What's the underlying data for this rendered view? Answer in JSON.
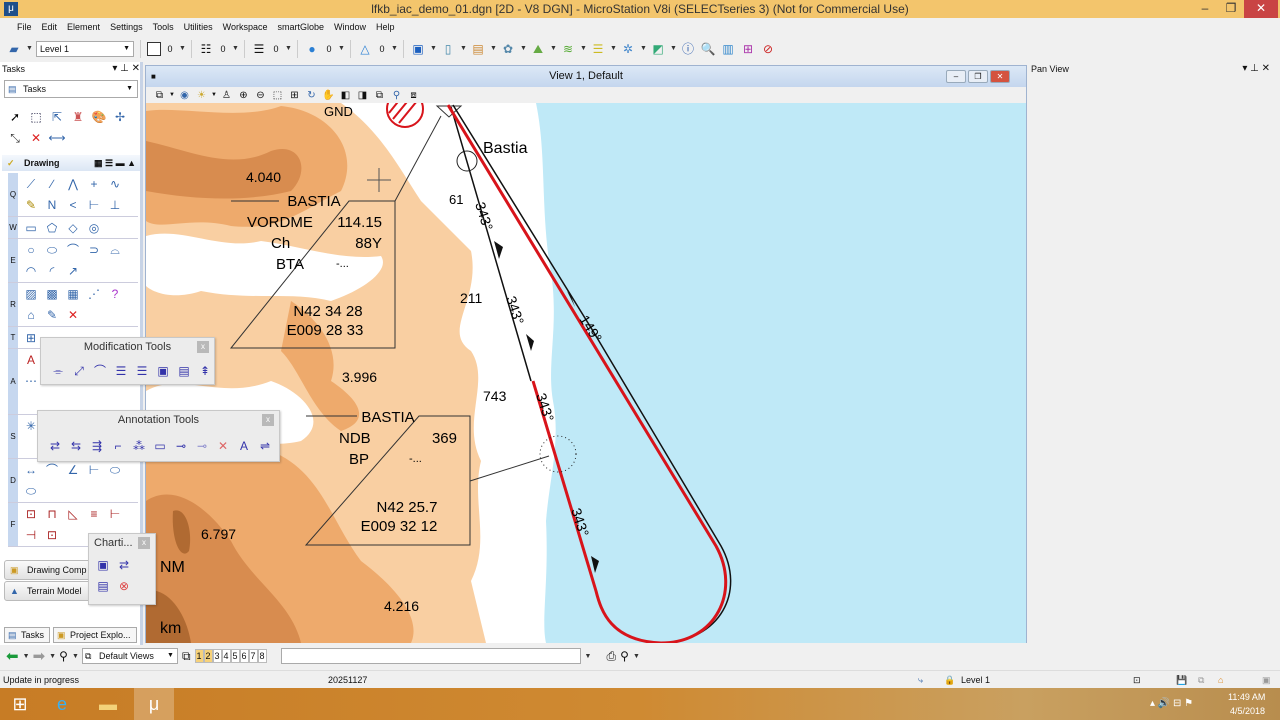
{
  "titlebar": {
    "title": "lfkb_iac_demo_01.dgn [2D - V8 DGN] - MicroStation V8i (SELECTseries 3) (Not for Commercial Use)",
    "minimize": "–",
    "restore": "❐",
    "close": "✕"
  },
  "menu": [
    "File",
    "Edit",
    "Element",
    "Settings",
    "Tools",
    "Utilities",
    "Workspace",
    "smartGlobe",
    "Window",
    "Help"
  ],
  "toolbar": {
    "level": "Level 1",
    "color": "0",
    "style": "0",
    "weight": "0",
    "transparency": "0",
    "priority": "0"
  },
  "tasks": {
    "title": "Tasks",
    "select_value": "Tasks",
    "quick_icons": [
      {
        "name": "select-icon",
        "g": "➚",
        "c": "#000"
      },
      {
        "name": "fence-icon",
        "g": "⬚",
        "c": "#224"
      },
      {
        "name": "move-icon",
        "g": "⇱",
        "c": "#36a"
      },
      {
        "name": "stamp-icon",
        "g": "♜",
        "c": "#c55"
      },
      {
        "name": "palette-icon",
        "g": "🎨",
        "c": "#c72"
      },
      {
        "name": "snap-icon",
        "g": "✢",
        "c": "#36a"
      },
      {
        "name": "scale-icon",
        "g": "⤡",
        "c": "#333"
      },
      {
        "name": "delete-icon",
        "g": "✕",
        "c": "#d22"
      },
      {
        "name": "measure-icon",
        "g": "⟷",
        "c": "#36a"
      }
    ],
    "drawing_label": "Drawing",
    "groups": [
      {
        "letter": "Q",
        "icons": [
          {
            "name": "place-smartline-icon",
            "g": "⟋",
            "c": "#36a"
          },
          {
            "name": "line-icon",
            "g": "∕",
            "c": "#36a"
          },
          {
            "name": "multiline-icon",
            "g": "⋀",
            "c": "#36a"
          },
          {
            "name": "point-icon",
            "g": "+",
            "c": "#36a"
          },
          {
            "name": "curve-icon",
            "g": "∿",
            "c": "#36a"
          },
          {
            "name": "freehand-icon",
            "g": "✎",
            "c": "#a80"
          },
          {
            "name": "bspline-icon",
            "g": "N",
            "c": "#36a"
          },
          {
            "name": "stream-icon",
            "g": "<",
            "c": "#36a"
          },
          {
            "name": "construct-icon",
            "g": "⊢",
            "c": "#36a"
          },
          {
            "name": "perpendicular-icon",
            "g": "⊥",
            "c": "#36a"
          }
        ]
      },
      {
        "letter": "W",
        "icons": [
          {
            "name": "rectangle-icon",
            "g": "▭",
            "c": "#36a"
          },
          {
            "name": "polygon-icon",
            "g": "⬠",
            "c": "#36a"
          },
          {
            "name": "shape-icon",
            "g": "◇",
            "c": "#36a"
          },
          {
            "name": "circle-center-icon",
            "g": "◎",
            "c": "#36a"
          }
        ]
      },
      {
        "letter": "E",
        "icons": [
          {
            "name": "circle-icon",
            "g": "○",
            "c": "#36a"
          },
          {
            "name": "ellipse-icon",
            "g": "⬭",
            "c": "#36a"
          },
          {
            "name": "arc-icon",
            "g": "⌒",
            "c": "#36a"
          },
          {
            "name": "arc-edit-icon",
            "g": "⊃",
            "c": "#36a"
          },
          {
            "name": "arc-modify-icon",
            "g": "⌓",
            "c": "#36a"
          },
          {
            "name": "half-ellipse-icon",
            "g": "◠",
            "c": "#36a"
          },
          {
            "name": "quarter-ellipse-icon",
            "g": "◜",
            "c": "#36a"
          },
          {
            "name": "arc-length-icon",
            "g": "↗",
            "c": "#36a"
          }
        ]
      },
      {
        "letter": "R",
        "icons": [
          {
            "name": "hatch-icon",
            "g": "▨",
            "c": "#36a"
          },
          {
            "name": "crosshatch-icon",
            "g": "▩",
            "c": "#36a"
          },
          {
            "name": "pattern-icon",
            "g": "▦",
            "c": "#36a"
          },
          {
            "name": "linear-pattern-icon",
            "g": "⋰",
            "c": "#36a"
          },
          {
            "name": "match-pattern-icon",
            "g": "?",
            "c": "#a3c"
          },
          {
            "name": "show-pattern-icon",
            "g": "⌂",
            "c": "#36a"
          },
          {
            "name": "edit-pattern-icon",
            "g": "✎",
            "c": "#36a"
          },
          {
            "name": "delete-pattern-icon",
            "g": "✕",
            "c": "#d22"
          }
        ]
      },
      {
        "letter": "T",
        "icons": [
          {
            "name": "tag-icon",
            "g": "⊞",
            "c": "#36a"
          }
        ]
      },
      {
        "letter": "A",
        "icons": [
          {
            "name": "place-text-icon",
            "g": "A",
            "c": "#b22"
          },
          {
            "name": "spell-check-icon",
            "g": "?",
            "c": "#a3c"
          },
          {
            "name": "edit-text-icon",
            "g": "A",
            "c": "#b22"
          },
          {
            "name": "display-text-icon",
            "g": "A",
            "c": "#b22"
          },
          {
            "name": "increment-text-icon",
            "g": "A",
            "c": "#b22"
          },
          {
            "name": "fill-text-icon",
            "g": "⋯",
            "c": "#36a"
          }
        ]
      },
      {
        "letter": "S",
        "icons": [
          {
            "name": "place-cell-icon",
            "g": "✳",
            "c": "#36a"
          },
          {
            "name": "select-cell-icon",
            "g": "↗",
            "c": "#333"
          }
        ]
      },
      {
        "letter": "D",
        "icons": [
          {
            "name": "dimension-length-icon",
            "g": "↔",
            "c": "#36a"
          },
          {
            "name": "dimension-angle-icon",
            "g": "⌒",
            "c": "#36a"
          },
          {
            "name": "dimension-angle-lines-icon",
            "g": "∠",
            "c": "#36a"
          },
          {
            "name": "dimension-element-icon",
            "g": "⊢",
            "c": "#36a"
          },
          {
            "name": "dimension-radial-icon",
            "g": "⬭",
            "c": "#36a"
          },
          {
            "name": "dimension-ordinate-icon",
            "g": "⬭",
            "c": "#36a"
          }
        ]
      },
      {
        "letter": "F",
        "icons": [
          {
            "name": "fence-place-icon",
            "g": "⊡",
            "c": "#a22"
          },
          {
            "name": "fence-modify-icon",
            "g": "⊓",
            "c": "#a22"
          },
          {
            "name": "fence-delete-icon",
            "g": "◺",
            "c": "#a22"
          },
          {
            "name": "fence-stretch-icon",
            "g": "≡",
            "c": "#a22"
          },
          {
            "name": "fence-manip-icon",
            "g": "⊢",
            "c": "#a22"
          },
          {
            "name": "fence-copy-icon",
            "g": "⊣",
            "c": "#a22"
          },
          {
            "name": "fence-move-icon",
            "g": "⊡",
            "c": "#a22"
          }
        ]
      }
    ],
    "drawing_comp": "Drawing Comp",
    "terrain_model": "Terrain Model",
    "tab_tasks": "Tasks",
    "tab_project": "Project Explo..."
  },
  "modification_tools": {
    "title": "Modification Tools",
    "icons": [
      {
        "name": "modify-point-icon",
        "g": "⌯",
        "c": "#33a"
      },
      {
        "name": "modify-line-icon",
        "g": "⤢",
        "c": "#33a"
      },
      {
        "name": "modify-arc-icon",
        "g": "⌒",
        "c": "#33a"
      },
      {
        "name": "align-text-icon",
        "g": "☰",
        "c": "#33a"
      },
      {
        "name": "align-text2-icon",
        "g": "☰",
        "c": "#33a"
      },
      {
        "name": "frame-icon",
        "g": "▣",
        "c": "#33a"
      },
      {
        "name": "scale-text-icon",
        "g": "▤",
        "c": "#33a"
      },
      {
        "name": "high-icon",
        "g": "⇞",
        "c": "#33a"
      }
    ]
  },
  "annotation_tools": {
    "title": "Annotation Tools",
    "icons": [
      {
        "name": "annotate-1-icon",
        "g": "⇄",
        "c": "#33a"
      },
      {
        "name": "annotate-2-icon",
        "g": "⇆",
        "c": "#33a"
      },
      {
        "name": "annotate-3-icon",
        "g": "⇶",
        "c": "#33a"
      },
      {
        "name": "leader-icon",
        "g": "⌐",
        "c": "#33a"
      },
      {
        "name": "annotate-cell-icon",
        "g": "⁂",
        "c": "#33a"
      },
      {
        "name": "abc-label-icon",
        "g": "▭",
        "c": "#33a"
      },
      {
        "name": "leader-label-icon",
        "g": "⊸",
        "c": "#33a"
      },
      {
        "name": "leader-label2-icon",
        "g": "⊸",
        "c": "#88c"
      },
      {
        "name": "delete-annotation-icon",
        "g": "✕",
        "c": "#d66"
      },
      {
        "name": "text-swap-icon",
        "g": "A",
        "c": "#33a"
      },
      {
        "name": "connect-icon",
        "g": "⇌",
        "c": "#33a"
      }
    ]
  },
  "charting_tools": {
    "title": "Charti...",
    "icons": [
      {
        "name": "chart-frame-icon",
        "g": "▣",
        "c": "#33a"
      },
      {
        "name": "chart-annotate-icon",
        "g": "⇄",
        "c": "#33a"
      },
      {
        "name": "chart-table-icon",
        "g": "▤",
        "c": "#33a"
      },
      {
        "name": "chart-delete-icon",
        "g": "⊗",
        "c": "#d44"
      }
    ]
  },
  "view": {
    "title": "View 1, Default",
    "minimize": "–",
    "restore": "❐",
    "close": "✕",
    "map": {
      "gnd": "GND",
      "spot_4040": "4.040",
      "spot_3996": "3.996",
      "spot_6797": "6.797",
      "spot_4216": "4.216",
      "spot_61": "61",
      "spot_211": "211",
      "spot_743": "743",
      "town": "Bastia",
      "vor": {
        "name": "BASTIA",
        "type": "VORDME",
        "freq": "114.15",
        "ch_label": "Ch",
        "ch": "88Y",
        "ident": "BTA",
        "morse": "-...",
        "lat": "N42 34 28",
        "lon": "E009 28 33"
      },
      "ndb": {
        "name": "BASTIA",
        "type": "NDB",
        "freq": "369",
        "ident": "BP",
        "morse": "-...",
        "lat": "N42 25.7",
        "lon": "E009 32 12"
      },
      "track_inbound": "343°",
      "track_outbound": "149°",
      "scale_nm": "NM",
      "scale_km": "km",
      "colors": {
        "sea": "#bfe9f7",
        "terrain_light": "#f9cfa2",
        "terrain_mid": "#eeaa6c",
        "terrain_dark": "#d88c4f",
        "terrain_darkest": "#b06a32",
        "procedure": "#d8141b"
      }
    }
  },
  "panview": {
    "title": "Pan View"
  },
  "bottom_toolbar": {
    "views_select": "Default Views",
    "pages": [
      "1",
      "2",
      "3",
      "4",
      "5",
      "6",
      "7",
      "8"
    ],
    "key_in": ""
  },
  "status": {
    "message": "Update in progress",
    "coord": "20251127",
    "level": "Level 1"
  },
  "taskbar": {
    "time": "11:49 AM",
    "date": "4/5/2018"
  }
}
